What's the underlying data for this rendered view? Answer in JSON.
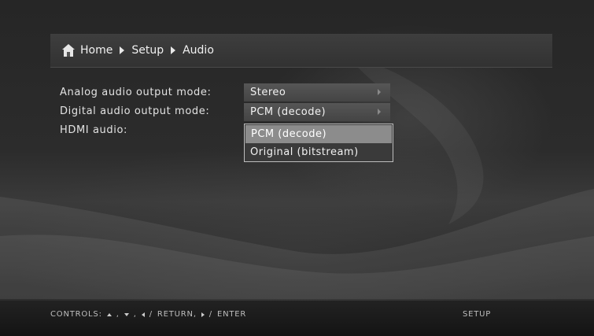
{
  "breadcrumb": {
    "home": "Home",
    "setup": "Setup",
    "audio": "Audio"
  },
  "settings": {
    "analog_label": "Analog audio output mode:",
    "analog_value": "Stereo",
    "digital_label": "Digital audio output mode:",
    "digital_value": "PCM (decode)",
    "hdmi_label": "HDMI audio:"
  },
  "dropdown": {
    "options": [
      "PCM (decode)",
      "Original (bitstream)"
    ],
    "selected": "PCM (decode)"
  },
  "footer": {
    "controls_label": "CONTROLS:",
    "return_label": "RETURN,",
    "enter_label": "ENTER",
    "setup_label": "SETUP"
  },
  "icons": {
    "home": "home-icon",
    "separator": "chevron-right-icon"
  }
}
